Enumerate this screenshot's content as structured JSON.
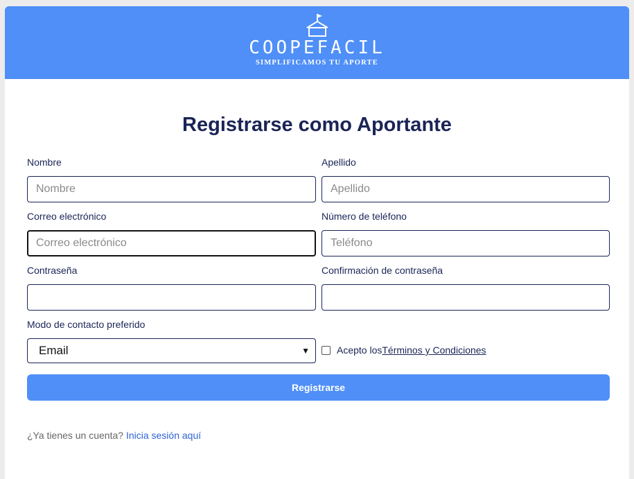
{
  "header": {
    "brand": "COOPEFACIL",
    "tagline": "SIMPLIFICAMOS TU APORTE",
    "logo_icon": "house-flag-icon",
    "color": "#4f8ff7"
  },
  "form": {
    "title": "Registrarse como Aportante",
    "first_name": {
      "label": "Nombre",
      "placeholder": "Nombre"
    },
    "last_name": {
      "label": "Apellido",
      "placeholder": "Apellido"
    },
    "email": {
      "label": "Correo electrónico",
      "placeholder": "Correo electrónico"
    },
    "phone": {
      "label": "Número de teléfono",
      "placeholder": "Teléfono"
    },
    "password": {
      "label": "Contraseña",
      "placeholder": ""
    },
    "password_confirm": {
      "label": "Confirmación de contraseña",
      "placeholder": ""
    },
    "contact_mode": {
      "label": "Modo de contacto preferido",
      "selected": "Email"
    },
    "terms": {
      "prefix": "Acepto los",
      "link": "Términos y Condiciones",
      "checked": false
    },
    "submit_label": "Registrarse",
    "footer": {
      "question": "¿Ya tienes un cuenta?",
      "link": "Inicia sesión aquí"
    }
  },
  "colors": {
    "primary": "#4f8ff7",
    "heading": "#1a2456",
    "link": "#2d63d8"
  }
}
